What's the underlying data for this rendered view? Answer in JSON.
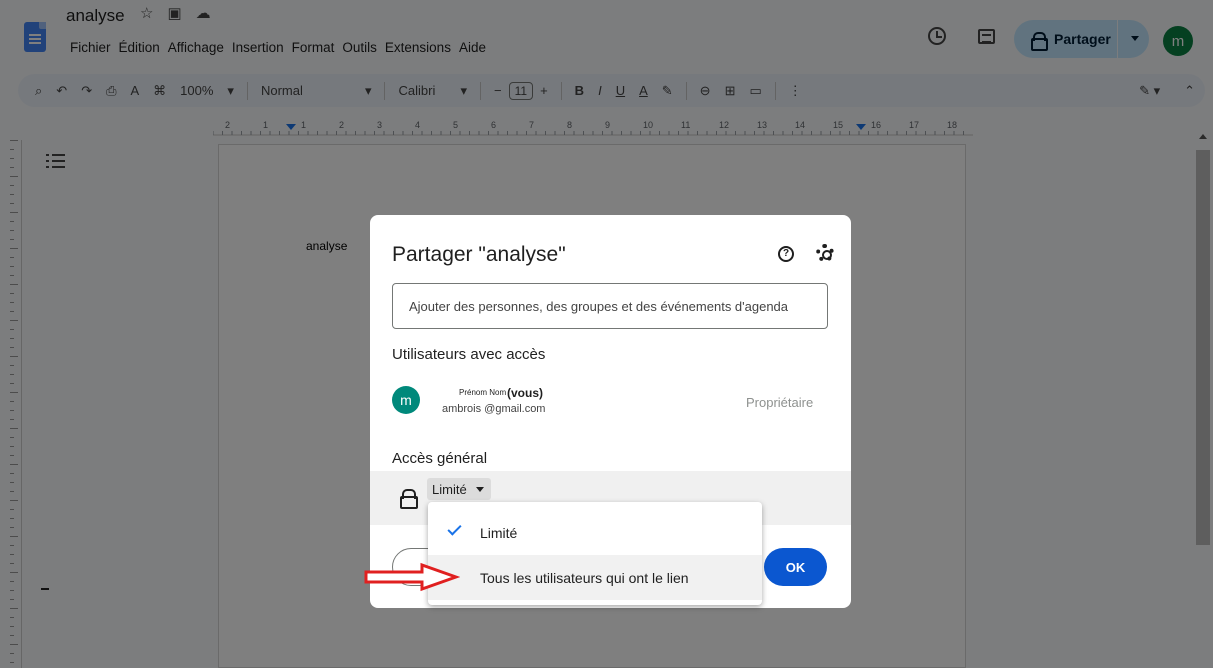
{
  "document": {
    "title": "analyse",
    "body_text": "analyse"
  },
  "menubar": [
    "Fichier",
    "Édition",
    "Affichage",
    "Insertion",
    "Format",
    "Outils",
    "Extensions",
    "Aide"
  ],
  "header": {
    "share_label": "Partager",
    "avatar_letter": "m"
  },
  "toolbar": {
    "zoom": "100%",
    "style": "Normal",
    "font": "Calibri",
    "font_size": "11"
  },
  "ruler": {
    "ticks": [
      "2",
      "1",
      "1",
      "2",
      "3",
      "4",
      "5",
      "6",
      "7",
      "8",
      "9",
      "10",
      "11",
      "12",
      "13",
      "14",
      "15",
      "16",
      "17",
      "18"
    ]
  },
  "share_dialog": {
    "title": "Partager \"analyse\"",
    "add_placeholder": "Ajouter des personnes, des groupes et des événements d'agenda",
    "users_heading": "Utilisateurs avec accès",
    "user": {
      "avatar_letter": "m",
      "name": "Prénom Nom",
      "you": "(vous)",
      "email": "ambrois @gmail.com",
      "role": "Propriétaire"
    },
    "general_heading": "Accès général",
    "access_value": "Limité",
    "ok_label": "OK"
  },
  "access_dropdown": {
    "options": [
      "Limité",
      "Tous les utilisateurs qui ont le lien"
    ],
    "selected_index": 0
  },
  "colors": {
    "accent": "#0b57d0",
    "share_button": "#c2e7ff",
    "annotation_arrow": "#e02020"
  }
}
